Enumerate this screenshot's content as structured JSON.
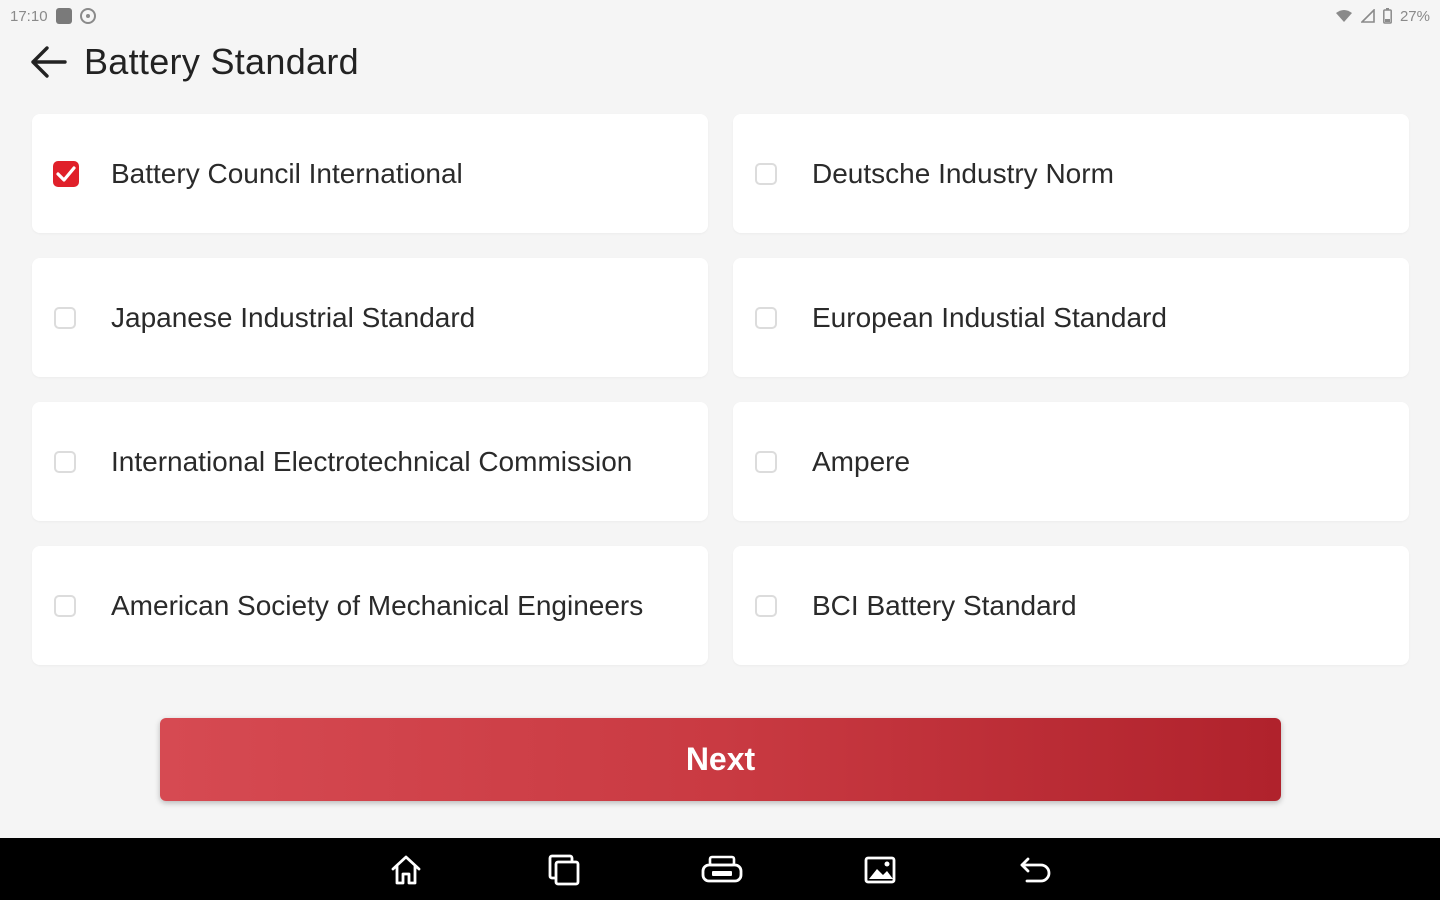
{
  "status_bar": {
    "time": "17:10",
    "battery": "27%",
    "left_icons": [
      "notification-square-icon",
      "settings-circle-icon"
    ],
    "right_icons": [
      "wifi-icon",
      "signal-icon",
      "battery-icon"
    ]
  },
  "header": {
    "title": "Battery Standard",
    "back_icon": "arrow-left-icon"
  },
  "options": [
    {
      "label": "Battery Council International",
      "checked": true
    },
    {
      "label": "Deutsche Industry Norm",
      "checked": false
    },
    {
      "label": "Japanese Industrial Standard",
      "checked": false
    },
    {
      "label": "European Industial Standard",
      "checked": false
    },
    {
      "label": "International Electrotechnical Commission",
      "checked": false
    },
    {
      "label": "Ampere",
      "checked": false
    },
    {
      "label": "American Society of Mechanical Engineers",
      "checked": false
    },
    {
      "label": "BCI Battery Standard",
      "checked": false
    }
  ],
  "next_button": {
    "label": "Next"
  },
  "nav_bar": {
    "icons": [
      "home-icon",
      "recent-apps-icon",
      "vci-icon",
      "gallery-icon",
      "back-icon"
    ]
  },
  "colors": {
    "accent": "#e0202a",
    "button_gradient_start": "#d64a52",
    "button_gradient_end": "#b0222c",
    "background": "#f5f5f5",
    "card": "#ffffff",
    "nav_bar": "#000000"
  }
}
